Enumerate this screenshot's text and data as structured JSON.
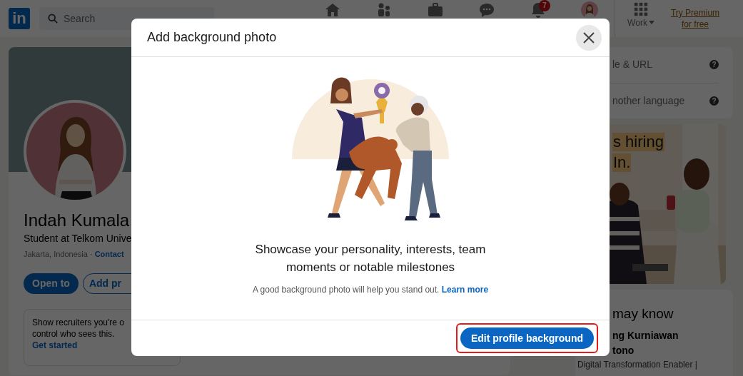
{
  "nav": {
    "logo": "in",
    "search_placeholder": "Search",
    "notifications_badge": "7",
    "work_label": "Work",
    "premium_link": "Try Premium for free"
  },
  "profile": {
    "name": "Indah Kumala",
    "headline": "Student at Telkom Unive",
    "location": "Jakarta, Indonesia · ",
    "contact_link": "Contact",
    "buttons": [
      {
        "label": "Open to",
        "kind": "primary"
      },
      {
        "label": "Add pr",
        "kind": "outline"
      }
    ],
    "open_to_work": {
      "lines": [
        "Show recruiters you're o",
        "control who sees this."
      ],
      "link": "Get started"
    }
  },
  "profile_settings": [
    {
      "label": "le & URL",
      "help": "?"
    },
    {
      "label": "nother language",
      "help": "?"
    }
  ],
  "ad": {
    "headline_lines": [
      "s hiring",
      "In."
    ]
  },
  "people_you_may_know": {
    "title": "may know",
    "name_lines": [
      "ng Kurniawan",
      "tono"
    ],
    "headline": "Digital Transformation Enabler |"
  },
  "modal": {
    "title": "Add background photo",
    "message": "Showcase your personality, interests, team moments or notable milestones",
    "hint": "A good background photo will help you stand out. ",
    "learn_more": "Learn more",
    "primary_button": "Edit profile background",
    "highlighted": true
  }
}
